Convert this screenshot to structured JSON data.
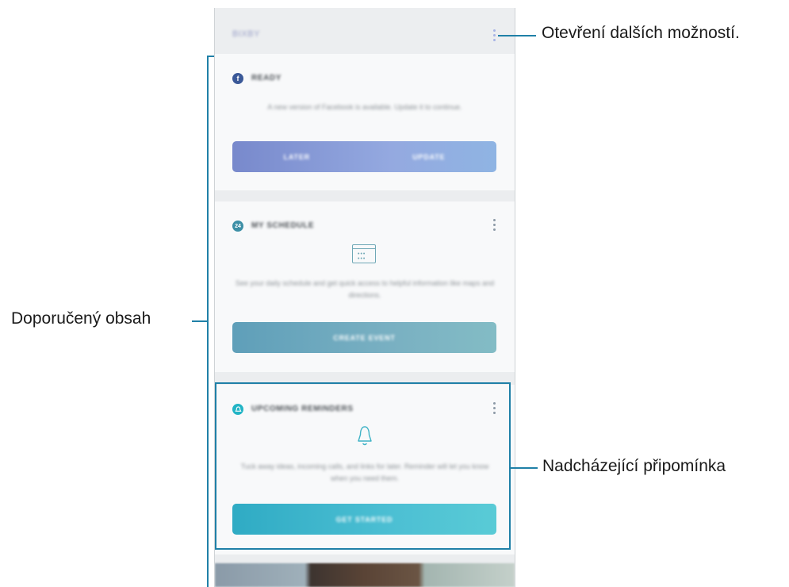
{
  "app": {
    "title": "BIXBY"
  },
  "cards": [
    {
      "title": "READY",
      "icon": "facebook-icon",
      "description": "A new version of Facebook is available. Update it to continue.",
      "buttons": [
        "LATER",
        "UPDATE"
      ]
    },
    {
      "title": "MY SCHEDULE",
      "icon": "calendar-icon",
      "icon_text": "24",
      "description": "See your daily schedule and get quick access to helpful information like maps and directions.",
      "buttons": [
        "CREATE EVENT"
      ]
    },
    {
      "title": "UPCOMING REMINDERS",
      "icon": "reminder-bell-icon",
      "description": "Tuck away ideas, incoming calls, and links for later. Reminder will let you know when you need them.",
      "buttons": [
        "GET STARTED"
      ]
    }
  ],
  "annotations": {
    "more_options": "Otevření dalších možností.",
    "recommended_content": "Doporučený obsah",
    "upcoming_reminder": "Nadcházející připomínka"
  },
  "colors": {
    "accent_line": "#1f80a7",
    "facebook": "#3b5998",
    "schedule": "#3d8fa6",
    "reminder": "#22b4c5"
  }
}
